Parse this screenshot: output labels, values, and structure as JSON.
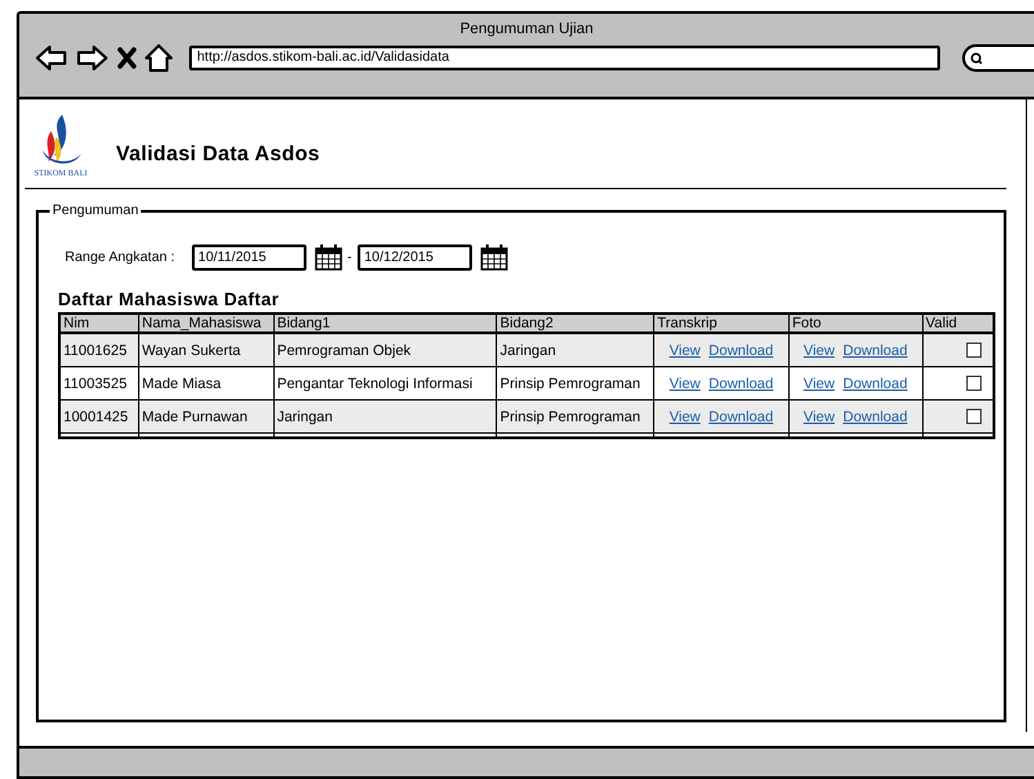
{
  "window": {
    "title": "Pengumuman Ujian",
    "url": "http://asdos.stikom-bali.ac.id/Validasidata"
  },
  "header": {
    "logo_text": "STIKOM BALI",
    "title": "Validasi Data Asdos"
  },
  "group": {
    "title": "Pengumuman",
    "range": {
      "label": "Range Angkatan :",
      "from": "10/11/2015",
      "separator": "-",
      "to": "10/12/2015"
    },
    "table": {
      "title": "Daftar Mahasiswa Daftar",
      "columns": [
        "Nim",
        "Nama_Mahasiswa",
        "Bidang1",
        "Bidang2",
        "Transkrip",
        "Foto",
        "Valid"
      ],
      "rows": [
        {
          "nim": "11001625",
          "nama": "Wayan Sukerta",
          "bidang1": "Pemrograman Objek",
          "bidang2": "Jaringan",
          "transkrip": {
            "view": "View",
            "download": "Download"
          },
          "foto": {
            "view": "View",
            "download": "Download"
          },
          "valid": {
            "checked": false
          }
        },
        {
          "nim": "11003525",
          "nama": "Made Miasa",
          "bidang1": "Pengantar Teknologi Informasi",
          "bidang2": "Prinsip Pemrograman",
          "transkrip": {
            "view": "View",
            "download": "Download"
          },
          "foto": {
            "view": "View",
            "download": "Download"
          },
          "valid": {
            "checked": false
          }
        },
        {
          "nim": "10001425",
          "nama": "Made Purnawan",
          "bidang1": "Jaringan",
          "bidang2": "Prinsip Pemrograman",
          "transkrip": {
            "view": "View",
            "download": "Download"
          },
          "foto": {
            "view": "View",
            "download": "Download"
          },
          "valid": {
            "checked": false
          }
        }
      ]
    }
  }
}
